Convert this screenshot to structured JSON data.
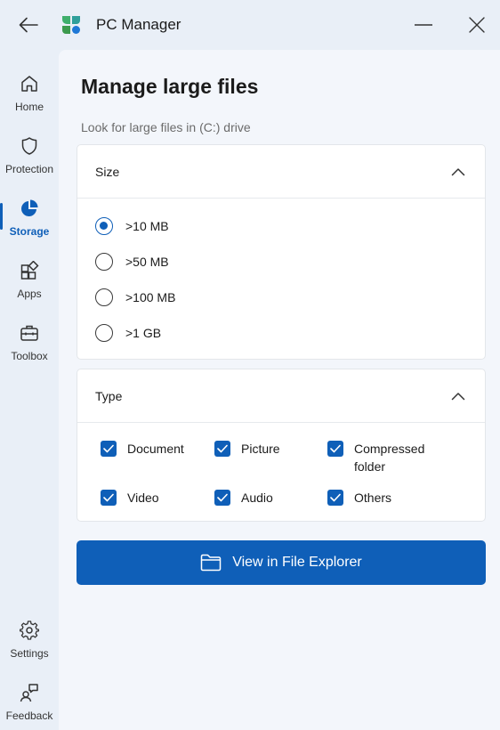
{
  "window": {
    "title": "PC Manager",
    "icons": {
      "back": "back-arrow-icon",
      "minimize": "minimize-icon",
      "close": "close-icon"
    }
  },
  "sidebar": {
    "items": [
      {
        "label": "Home",
        "icon": "home-icon",
        "active": false
      },
      {
        "label": "Protection",
        "icon": "shield-icon",
        "active": false
      },
      {
        "label": "Storage",
        "icon": "pie-chart-icon",
        "active": true
      },
      {
        "label": "Apps",
        "icon": "apps-grid-icon",
        "active": false
      },
      {
        "label": "Toolbox",
        "icon": "toolbox-icon",
        "active": false
      }
    ],
    "footer_items": [
      {
        "label": "Settings",
        "icon": "gear-icon"
      },
      {
        "label": "Feedback",
        "icon": "feedback-icon"
      }
    ]
  },
  "main": {
    "title": "Manage large files",
    "subtitle": "Look for large files in (C:) drive",
    "size_section": {
      "title": "Size",
      "options": [
        {
          "label": ">10 MB",
          "checked": true
        },
        {
          "label": ">50 MB",
          "checked": false
        },
        {
          "label": ">100 MB",
          "checked": false
        },
        {
          "label": ">1 GB",
          "checked": false
        }
      ]
    },
    "type_section": {
      "title": "Type",
      "options": [
        {
          "label": "Document",
          "checked": true
        },
        {
          "label": "Picture",
          "checked": true
        },
        {
          "label": "Compressed folder",
          "checked": true
        },
        {
          "label": "Video",
          "checked": true
        },
        {
          "label": "Audio",
          "checked": true
        },
        {
          "label": "Others",
          "checked": true
        }
      ]
    },
    "primary_button": {
      "label": "View in File Explorer",
      "icon": "folder-icon"
    }
  },
  "colors": {
    "accent": "#0f5fb8",
    "window_bg": "#e9eff7",
    "pane_bg": "#f3f6fb",
    "card_bg": "#ffffff"
  }
}
